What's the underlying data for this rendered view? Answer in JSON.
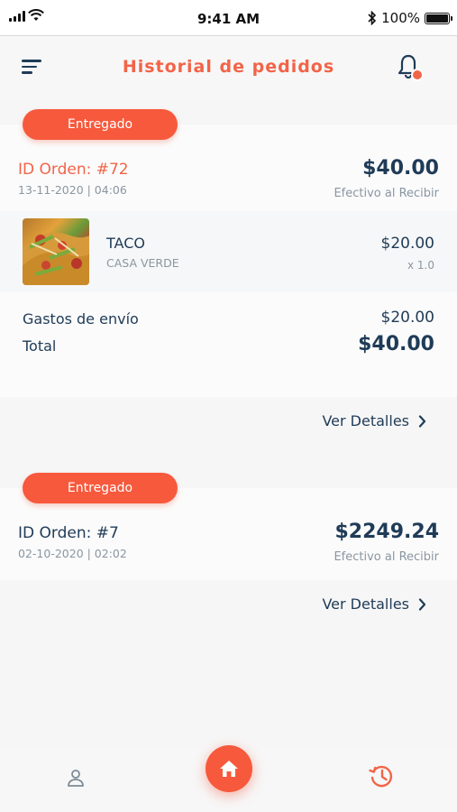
{
  "status_bar": {
    "time": "9:41 AM",
    "battery": "100%"
  },
  "header": {
    "title": "Historial de pedidos"
  },
  "orders": [
    {
      "status": "Entregado",
      "id": "ID Orden: #72",
      "date": "13-11-2020 | 04:06",
      "total": "$40.00",
      "payment": "Efectivo al Recibir",
      "item": {
        "name": "TACO",
        "store": "CASA VERDE",
        "price": "$20.00",
        "qty": "x 1.0"
      },
      "shipping_label": "Gastos de envío",
      "shipping_value": "$20.00",
      "total_label": "Total",
      "total_value": "$40.00",
      "details_label": "Ver Detalles"
    },
    {
      "status": "Entregado",
      "id": "ID Orden: #7",
      "date": "02-10-2020 | 02:02",
      "total": "$2249.24",
      "payment": "Efectivo al Recibir",
      "details_label": "Ver Detalles"
    }
  ],
  "colors": {
    "accent": "#f7593c",
    "title": "#f26448",
    "text": "#1f3b57",
    "muted": "#8a96a1"
  },
  "icons": [
    "menu-icon",
    "bell-icon",
    "user-icon",
    "home-icon",
    "history-icon",
    "chevron-right-icon"
  ]
}
